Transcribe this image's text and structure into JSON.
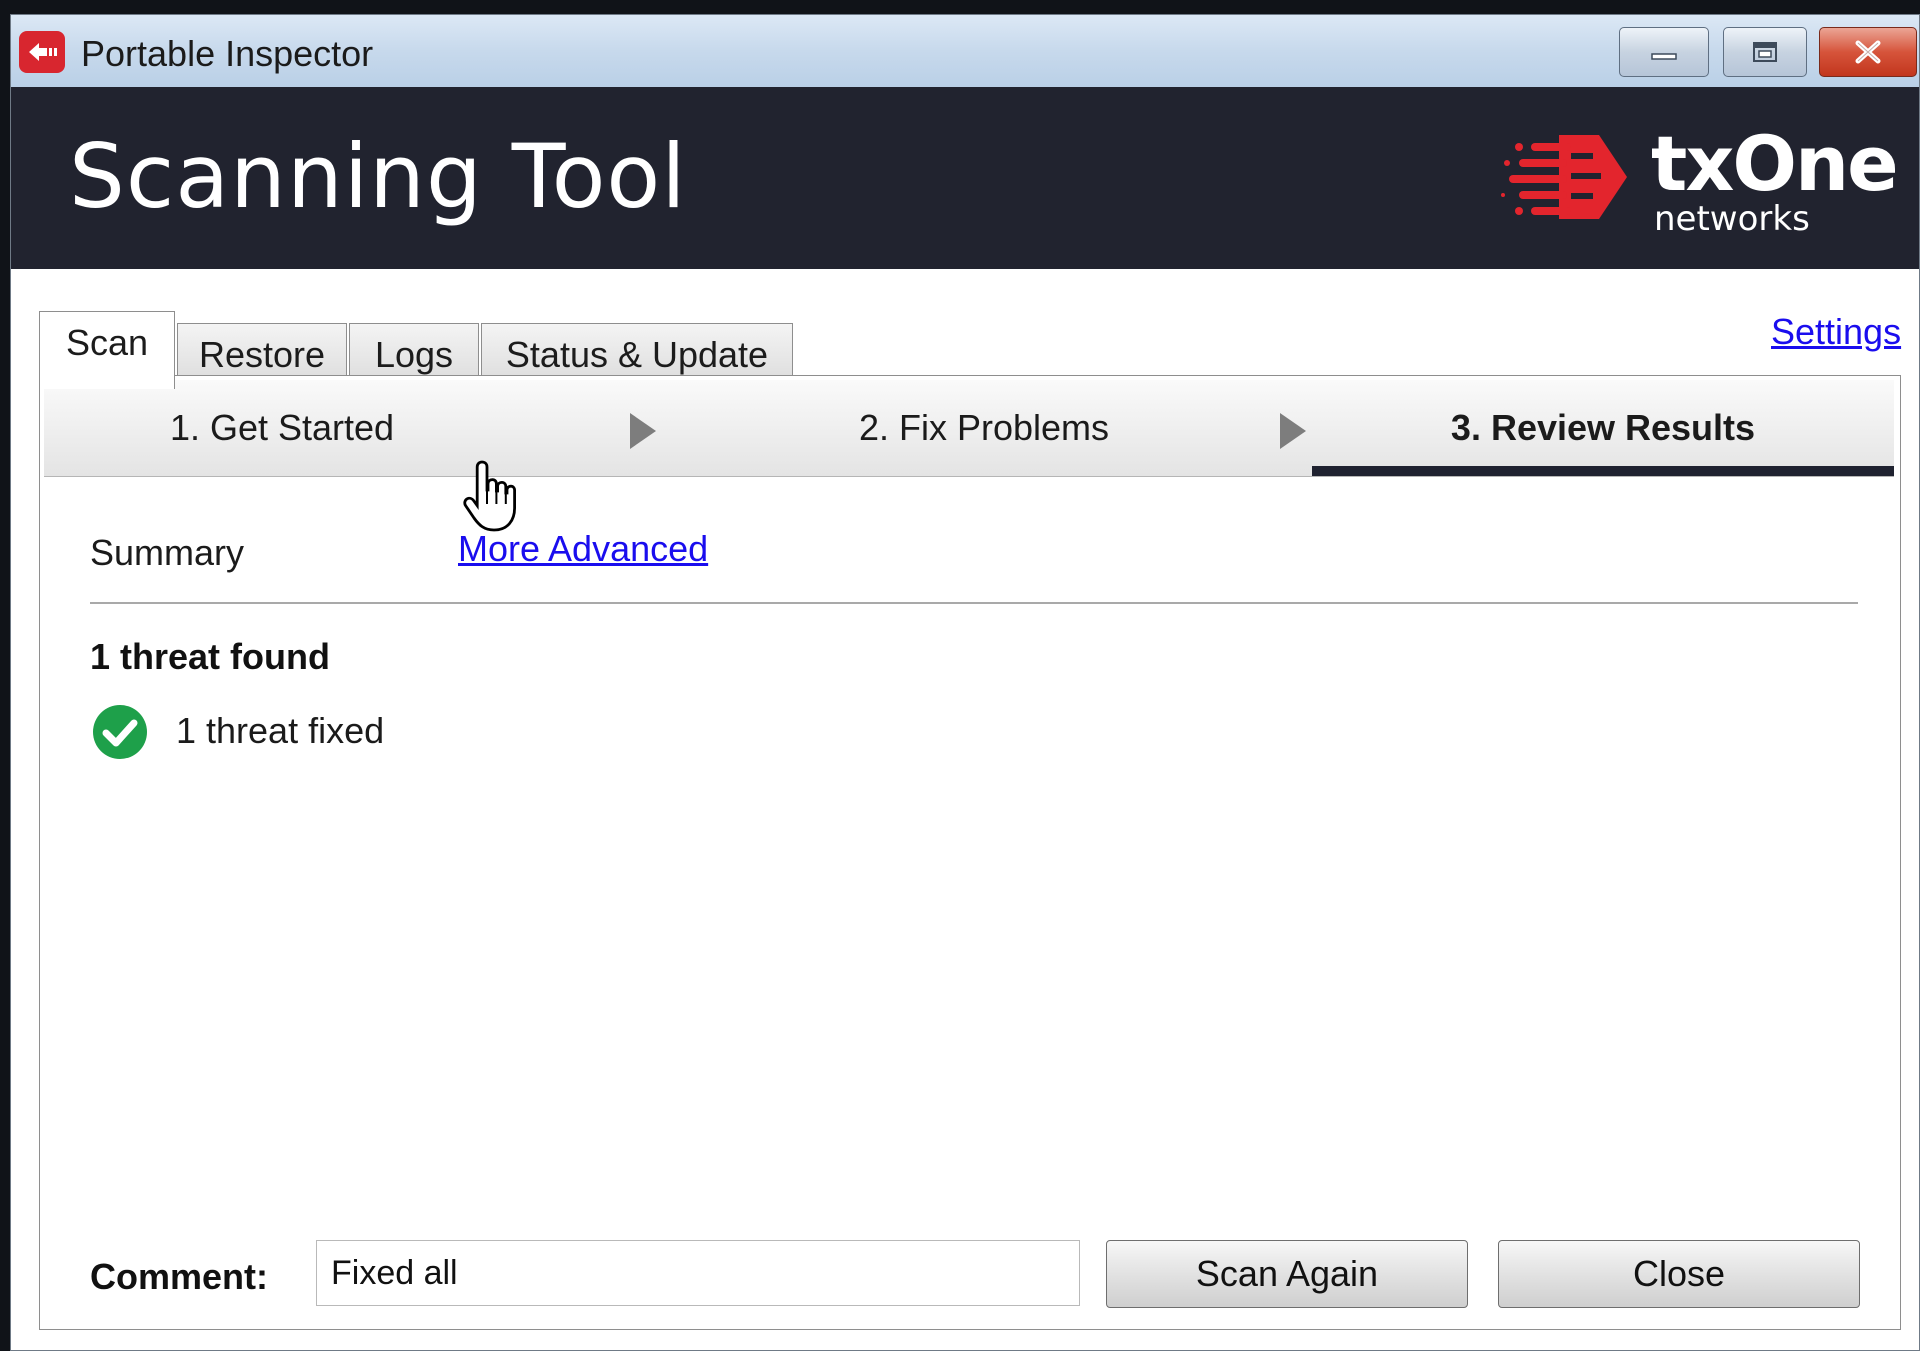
{
  "window": {
    "title": "Portable Inspector"
  },
  "header": {
    "title": "Scanning Tool",
    "brand_name": "txOne",
    "brand_sub": "networks",
    "brand_color": "#e3252d"
  },
  "tabs": [
    {
      "label": "Scan",
      "active": true
    },
    {
      "label": "Restore",
      "active": false
    },
    {
      "label": "Logs",
      "active": false
    },
    {
      "label": "Status & Update",
      "active": false
    }
  ],
  "settings_link": "Settings",
  "steps": [
    {
      "label": "1. Get Started",
      "current": false
    },
    {
      "label": "2. Fix Problems",
      "current": false
    },
    {
      "label": "3. Review Results",
      "current": true
    }
  ],
  "results": {
    "summary_label": "Summary",
    "advanced_link": "More Advanced",
    "heading": "1 threat found",
    "item": "1 threat fixed",
    "check_color": "#1ea04a"
  },
  "footer": {
    "comment_label": "Comment:",
    "comment_value": "Fixed all",
    "scan_again": "Scan Again",
    "close": "Close"
  }
}
